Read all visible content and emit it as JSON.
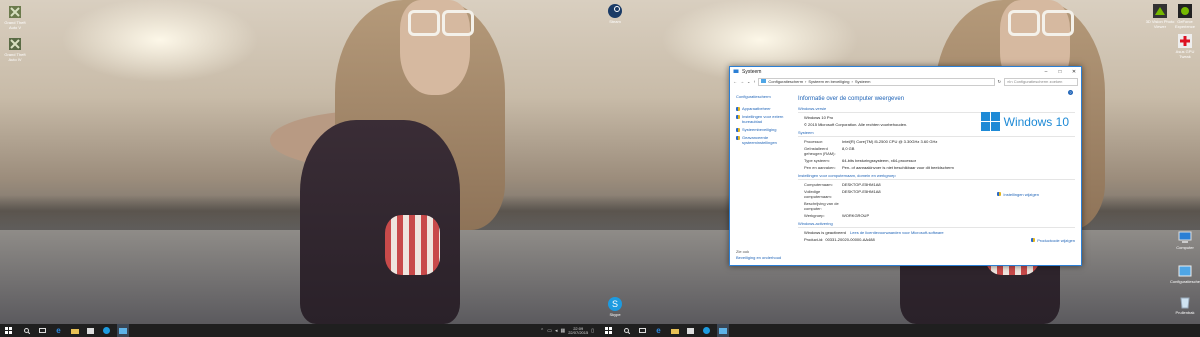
{
  "left_monitor": {
    "desktop_icons": [
      {
        "label": "Grand Theft Auto V"
      },
      {
        "label": "Grand Theft Auto IV"
      }
    ]
  },
  "right_monitor": {
    "desktop_icons_left": [
      {
        "label": "Steam"
      },
      {
        "label": "Skype"
      }
    ],
    "desktop_icons_right": [
      {
        "label": "3D Vision Photo Viewer"
      },
      {
        "label": "GeForce Experience"
      },
      {
        "label": "Asus GPU Tweak"
      },
      {
        "label": "Computer"
      },
      {
        "label": "Configuratiescherm"
      },
      {
        "label": "Prullenbak"
      }
    ]
  },
  "taskbar": {
    "clock_time": "22:09",
    "clock_date": "22/07/2015"
  },
  "system_window": {
    "title": "Systeem",
    "address": {
      "crumb1": "Configuratiescherm",
      "crumb2": "Systeem en beveiliging",
      "crumb3": "Systeem",
      "search_placeholder": "In Configuratiescherm zoeken"
    },
    "left_pane": {
      "home": "Configuratiescherm",
      "links": [
        "Apparaatbeheer",
        "Instellingen voor extern bureaublad",
        "Systeembeveiliging",
        "Geavanceerde systeeminstellingen"
      ],
      "see_also": "Zie ook",
      "see_also_link": "Beveiliging en onderhoud"
    },
    "heading": "Informatie over de computer weergeven",
    "edition_section": "Windows-versie",
    "edition": "Windows 10 Pro",
    "copyright": "© 2015 Microsoft Corporation. Alle rechten voorbehouden.",
    "windows_logo_text": "Windows 10",
    "system_section": "Systeem",
    "system_rows": [
      {
        "k": "Processor:",
        "v": "Intel(R) Core(TM) i5-2500 CPU @ 3.30GHz   3.60 GHz"
      },
      {
        "k": "Geïnstalleerd geheugen (RAM):",
        "v": "8,0 GB"
      },
      {
        "k": "Type systeem:",
        "v": "64-bits besturingssysteem, x64-processor"
      },
      {
        "k": "Pen en aanraken:",
        "v": "Pen- of aanraakinvoer is niet beschikbaar voor dit beeldscherm"
      }
    ],
    "computer_section": "Instellingen voor computernaam, domein en werkgroep",
    "computer_rows": [
      {
        "k": "Computernaam:",
        "v": "DESKTOP-E5HM1A8"
      },
      {
        "k": "Volledige computernaam:",
        "v": "DESKTOP-E5HM1A8"
      },
      {
        "k": "Beschrijving van de computer:",
        "v": ""
      },
      {
        "k": "Werkgroep:",
        "v": "WORKGROUP"
      }
    ],
    "change_settings": "Instellingen wijzigen",
    "activation_section": "Windows-activering",
    "activation_status": "Windows is geactiveerd",
    "license_link": "Lees de licentievoorwaarden voor Microsoft-software",
    "product_id_label": "Product-id:",
    "product_id": "00331-20020-00000-AA488",
    "change_product_key": "Productcode wijzigen"
  }
}
